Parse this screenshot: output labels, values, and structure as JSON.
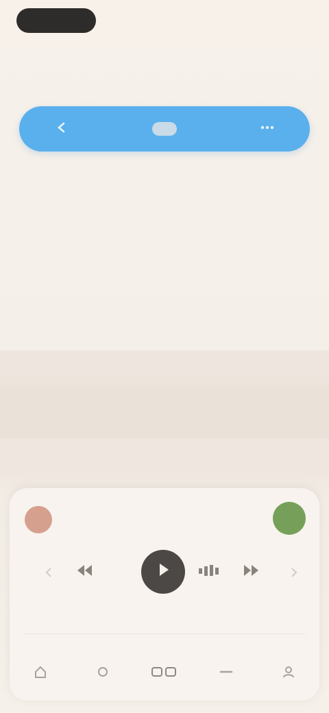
{
  "status_bar": {
    "time": "",
    "right_text": ""
  },
  "header": {
    "segments": [
      {
        "label": "",
        "icon": "back-icon"
      },
      {
        "label": "",
        "active": true
      },
      {
        "label": "",
        "icon": "more-icon"
      }
    ]
  },
  "rows": [
    {
      "label": "",
      "value": ""
    },
    {
      "label": "",
      "value": ""
    },
    {
      "label": "",
      "value": ""
    },
    {
      "label": "",
      "value": ""
    }
  ],
  "player": {
    "title": "",
    "cancel_color": "#d6a08e",
    "confirm_color": "#76a05a",
    "label": "",
    "controls": [
      "rewind-icon",
      "play-icon",
      "bars-icon",
      "forward-icon"
    ],
    "nav_items": [
      "nav-item-1",
      "nav-item-2",
      "nav-item-3",
      "nav-item-4",
      "nav-item-5"
    ]
  },
  "colors": {
    "accent": "#5ab0ec",
    "background": "#f6f0ea",
    "play_button": "#4c4845"
  }
}
